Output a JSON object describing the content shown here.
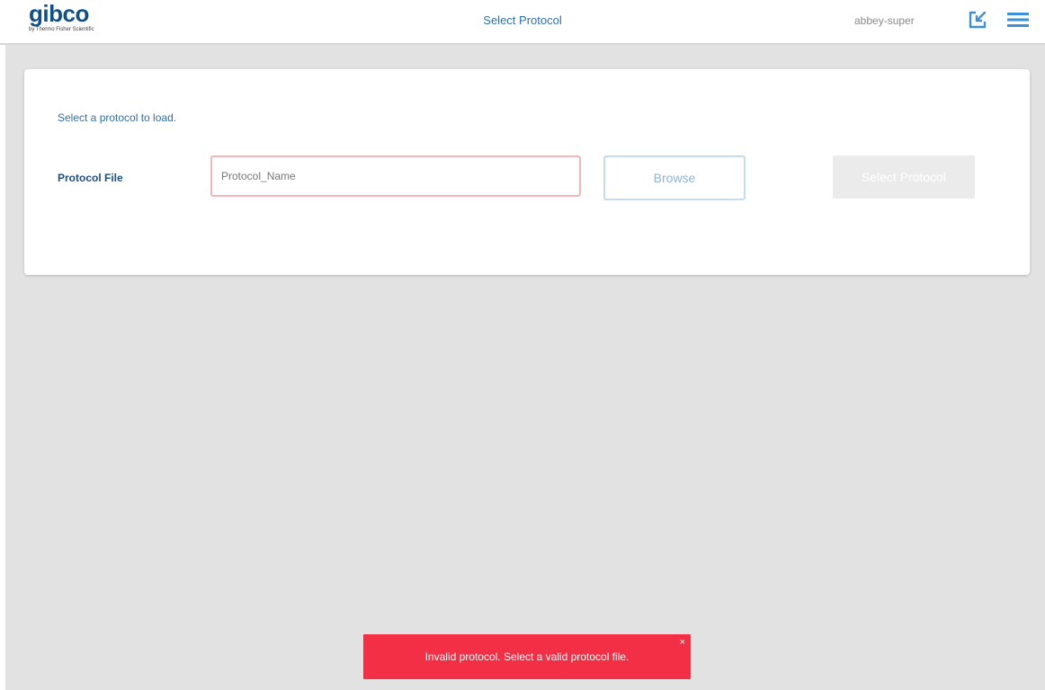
{
  "header": {
    "logo_text": "gibco",
    "logo_subtext": "by Thermo Fisher Scientific",
    "title": "Select Protocol",
    "user": "abbey-super",
    "icons": [
      "launch-icon",
      "menu-icon"
    ],
    "accent_color": "#2f6fa8"
  },
  "card": {
    "instruction": "Select a protocol to load.",
    "field_label": "Protocol File",
    "file_input_value": "Protocol_Name",
    "browse_label": "Browse",
    "select_label": "Select Protocol",
    "select_enabled": false
  },
  "toast": {
    "message": "Invalid protocol. Select a valid protocol file.",
    "close_label": "×",
    "color": "#f22f45"
  }
}
